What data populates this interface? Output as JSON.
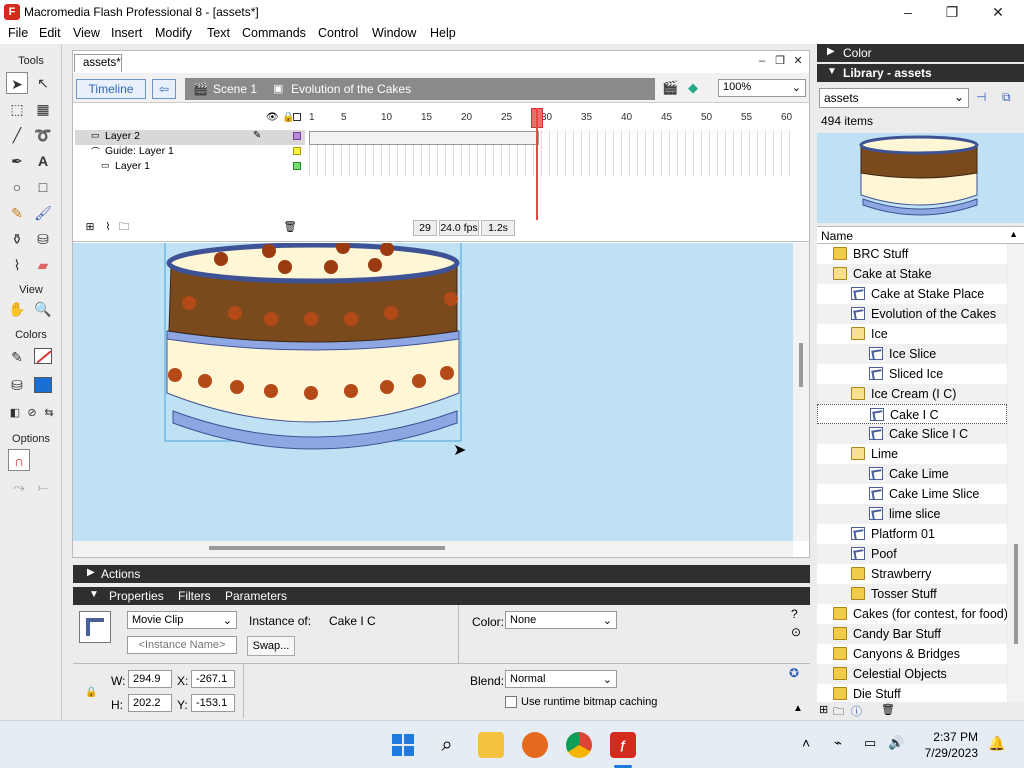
{
  "window": {
    "title": "Macromedia Flash Professional 8 - [assets*]",
    "app_icon": "F"
  },
  "menu": [
    "File",
    "Edit",
    "View",
    "Insert",
    "Modify",
    "Text",
    "Commands",
    "Control",
    "Window",
    "Help"
  ],
  "tools": {
    "header": "Tools",
    "view_label": "View",
    "colors_label": "Colors",
    "options_label": "Options"
  },
  "document": {
    "tab": "assets*",
    "timeline_button": "Timeline",
    "scene": "Scene 1",
    "symbol": "Evolution of the Cakes",
    "zoom": "100%"
  },
  "timeline": {
    "layers": [
      {
        "name": "Layer 2"
      },
      {
        "name": "Guide: Layer 1"
      },
      {
        "name": "Layer 1"
      }
    ],
    "ruler": [
      "1",
      "5",
      "10",
      "15",
      "20",
      "25",
      "30",
      "35",
      "40",
      "45",
      "50",
      "55",
      "60"
    ],
    "current_frame": "29",
    "fps": "24.0 fps",
    "time": "1.2s"
  },
  "actions_panel": {
    "label": "Actions"
  },
  "properties": {
    "tabs": [
      "Properties",
      "Filters",
      "Parameters"
    ],
    "symbol_type": "Movie Clip",
    "instance_name_placeholder": "<Instance Name>",
    "instance_of_label": "Instance of:",
    "instance_of": "Cake I C",
    "swap_label": "Swap...",
    "color_label": "Color:",
    "color_value": "None",
    "blend_label": "Blend:",
    "blend_value": "Normal",
    "bitmap_caching": "Use runtime bitmap caching",
    "w_label": "W:",
    "w": "294.9",
    "x_label": "X:",
    "x": "-267.1",
    "h_label": "H:",
    "h": "202.2",
    "y_label": "Y:",
    "y": "-153.1"
  },
  "color_panel": {
    "title": "Color"
  },
  "library": {
    "title": "Library - assets",
    "selected_library": "assets",
    "count": "494 items",
    "column_name": "Name",
    "items": [
      {
        "label": "BRC Stuff",
        "icon": "folder"
      },
      {
        "label": "Cake at Stake",
        "icon": "folderopen"
      },
      {
        "label": "Cake at Stake Place",
        "icon": "clip"
      },
      {
        "label": "Evolution of the Cakes",
        "icon": "clip"
      },
      {
        "label": "Ice",
        "icon": "folderopen"
      },
      {
        "label": "Ice Slice",
        "icon": "clip"
      },
      {
        "label": "Sliced Ice",
        "icon": "clip"
      },
      {
        "label": "Ice Cream (I C)",
        "icon": "folderopen"
      },
      {
        "label": "Cake I C",
        "icon": "clip"
      },
      {
        "label": "Cake Slice I C",
        "icon": "clip"
      },
      {
        "label": "Lime",
        "icon": "folderopen"
      },
      {
        "label": "Cake Lime",
        "icon": "clip"
      },
      {
        "label": "Cake Lime Slice",
        "icon": "clip"
      },
      {
        "label": "lime slice",
        "icon": "clip"
      },
      {
        "label": "Platform 01",
        "icon": "clip"
      },
      {
        "label": "Poof",
        "icon": "clip"
      },
      {
        "label": "Strawberry",
        "icon": "folder"
      },
      {
        "label": "Tosser Stuff",
        "icon": "folder"
      },
      {
        "label": "Cakes (for contest, for food)",
        "icon": "folder"
      },
      {
        "label": "Candy Bar Stuff",
        "icon": "folder"
      },
      {
        "label": "Canyons & Bridges",
        "icon": "folder"
      },
      {
        "label": "Celestial Objects",
        "icon": "folder"
      },
      {
        "label": "Die Stuff",
        "icon": "folder"
      }
    ]
  },
  "taskbar": {
    "time": "2:37 PM",
    "date": "7/29/2023"
  },
  "colors": {
    "stage": "#bfe1f3",
    "panel_header": "#2f2f2f",
    "playhead": "#e44444"
  }
}
